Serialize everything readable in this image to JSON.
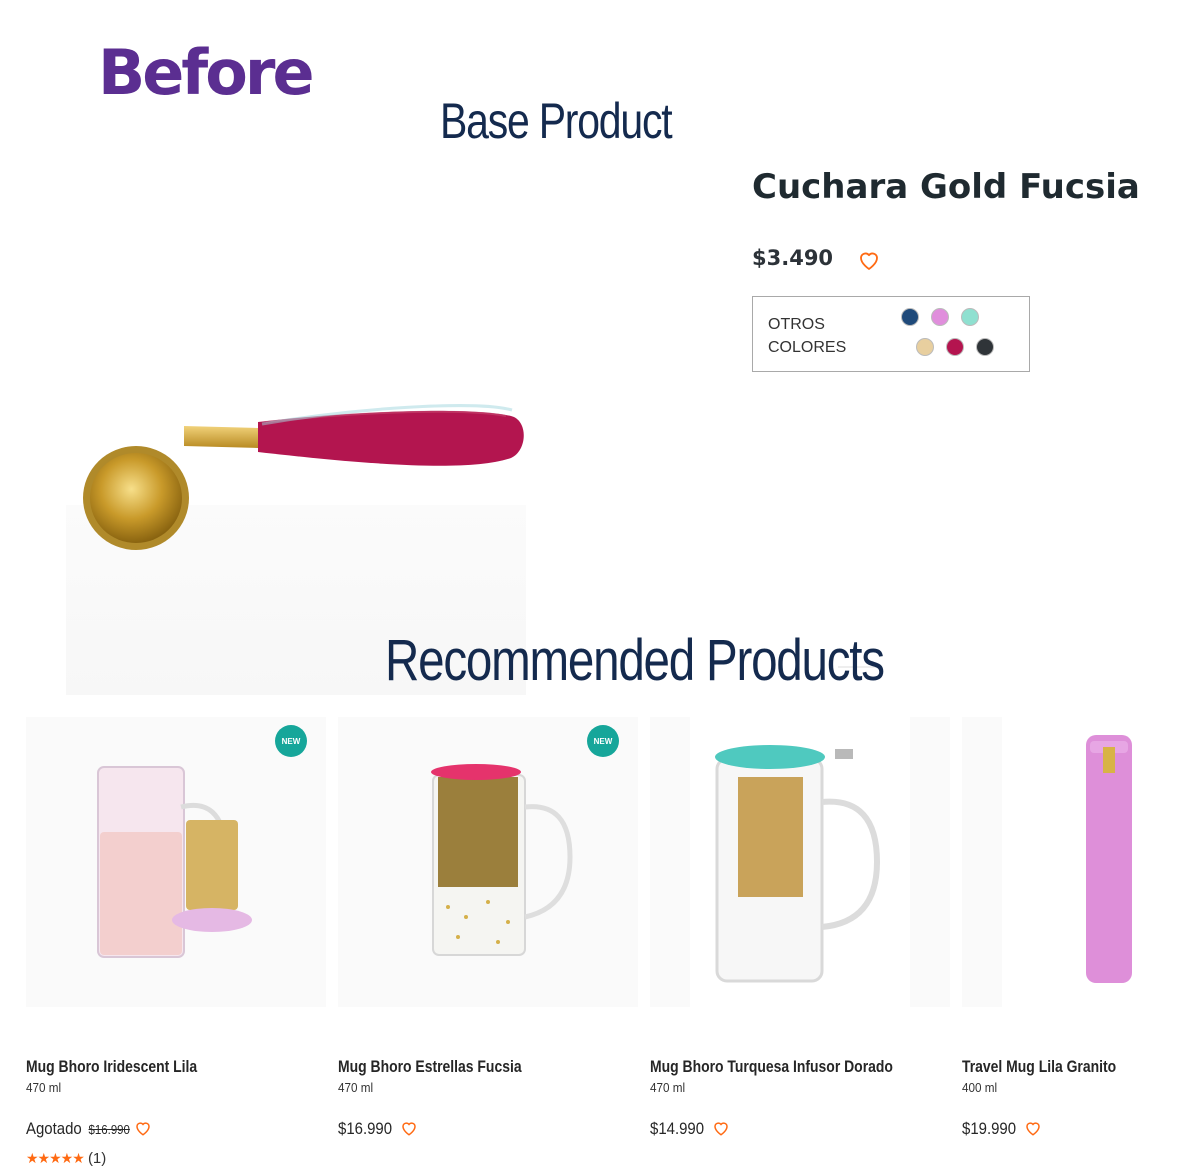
{
  "headings": {
    "before": "Before",
    "base_product": "Base Product",
    "recommended": "Recommended Products"
  },
  "product": {
    "name": "Cuchara Gold Fucsia",
    "price": "$3.490",
    "other_colors_label": "OTROS COLORES",
    "swatches": [
      "#1f4a7a",
      "#e08edc",
      "#8fe0d0",
      "#e8cf9f",
      "#b4144f",
      "#2f3438"
    ]
  },
  "recommended": [
    {
      "name": "Mug Bhoro Iridescent Lila",
      "size": "470 ml",
      "status": "Agotado",
      "price": "$16.990",
      "badge": "NEW",
      "rating_count": "(1)"
    },
    {
      "name": "Mug Bhoro Estrellas Fucsia",
      "size": "470 ml",
      "price": "$16.990",
      "badge": "NEW"
    },
    {
      "name": "Mug Bhoro Turquesa Infusor Dorado",
      "size": "470 ml",
      "price": "$14.990"
    },
    {
      "name": "Travel Mug Lila Granito",
      "size": "400 ml",
      "price": "$19.990"
    }
  ],
  "colors": {
    "accent": "#ff6a13",
    "badge": "#16a69a",
    "title": "#142a4e",
    "before": "#5b2e91"
  }
}
